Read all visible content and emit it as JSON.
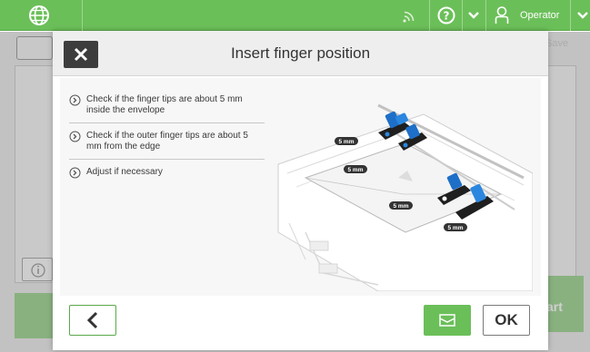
{
  "topbar": {
    "user_label": "Operator",
    "icons": [
      "globe-icon",
      "signal-icon",
      "help-icon",
      "chevron-down-icon",
      "user-icon",
      "chevron-down-icon"
    ],
    "accent_color": "#6bbf59"
  },
  "background": {
    "save_label": "Save",
    "start_label": "art"
  },
  "dialog": {
    "title": "Insert finger position",
    "steps": [
      "Check if the finger tips are about 5 mm inside the envelope",
      "Check if the outer finger tips are about 5 mm from the edge",
      "Adjust if necessary"
    ],
    "illustration": {
      "labels": [
        "5 mm",
        "5 mm",
        "5 mm",
        "5 mm"
      ]
    },
    "ok_label": "OK",
    "icons": [
      "close-icon",
      "chevron-left-icon",
      "envelope-icon"
    ]
  }
}
